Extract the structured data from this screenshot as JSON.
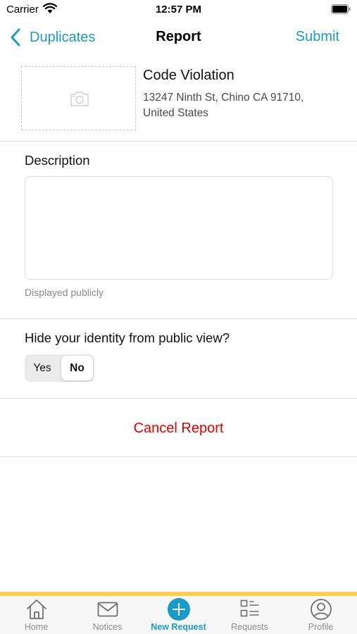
{
  "status_bar": {
    "carrier": "Carrier",
    "time": "12:57 PM"
  },
  "nav": {
    "back_label": "Duplicates",
    "title": "Report",
    "submit_label": "Submit"
  },
  "report": {
    "category": "Code Violation",
    "address": "13247 Ninth St, Chino CA 91710, United States"
  },
  "description": {
    "label": "Description",
    "value": "",
    "placeholder": "",
    "hint": "Displayed publicly"
  },
  "identity": {
    "question": "Hide your identity from public view?",
    "yes_label": "Yes",
    "no_label": "No",
    "selected": "No"
  },
  "cancel_label": "Cancel Report",
  "tab_bar": {
    "accent_color": "#ffce4f",
    "active_color": "#1a9bc6",
    "tabs": [
      {
        "label": "Home",
        "icon": "home-icon"
      },
      {
        "label": "Notices",
        "icon": "envelope-icon"
      },
      {
        "label": "New Request",
        "icon": "plus-circle-icon",
        "active": true
      },
      {
        "label": "Requests",
        "icon": "list-icon"
      },
      {
        "label": "Profile",
        "icon": "person-icon"
      }
    ]
  },
  "colors": {
    "link": "#1a9bc6",
    "danger": "#e60000"
  }
}
